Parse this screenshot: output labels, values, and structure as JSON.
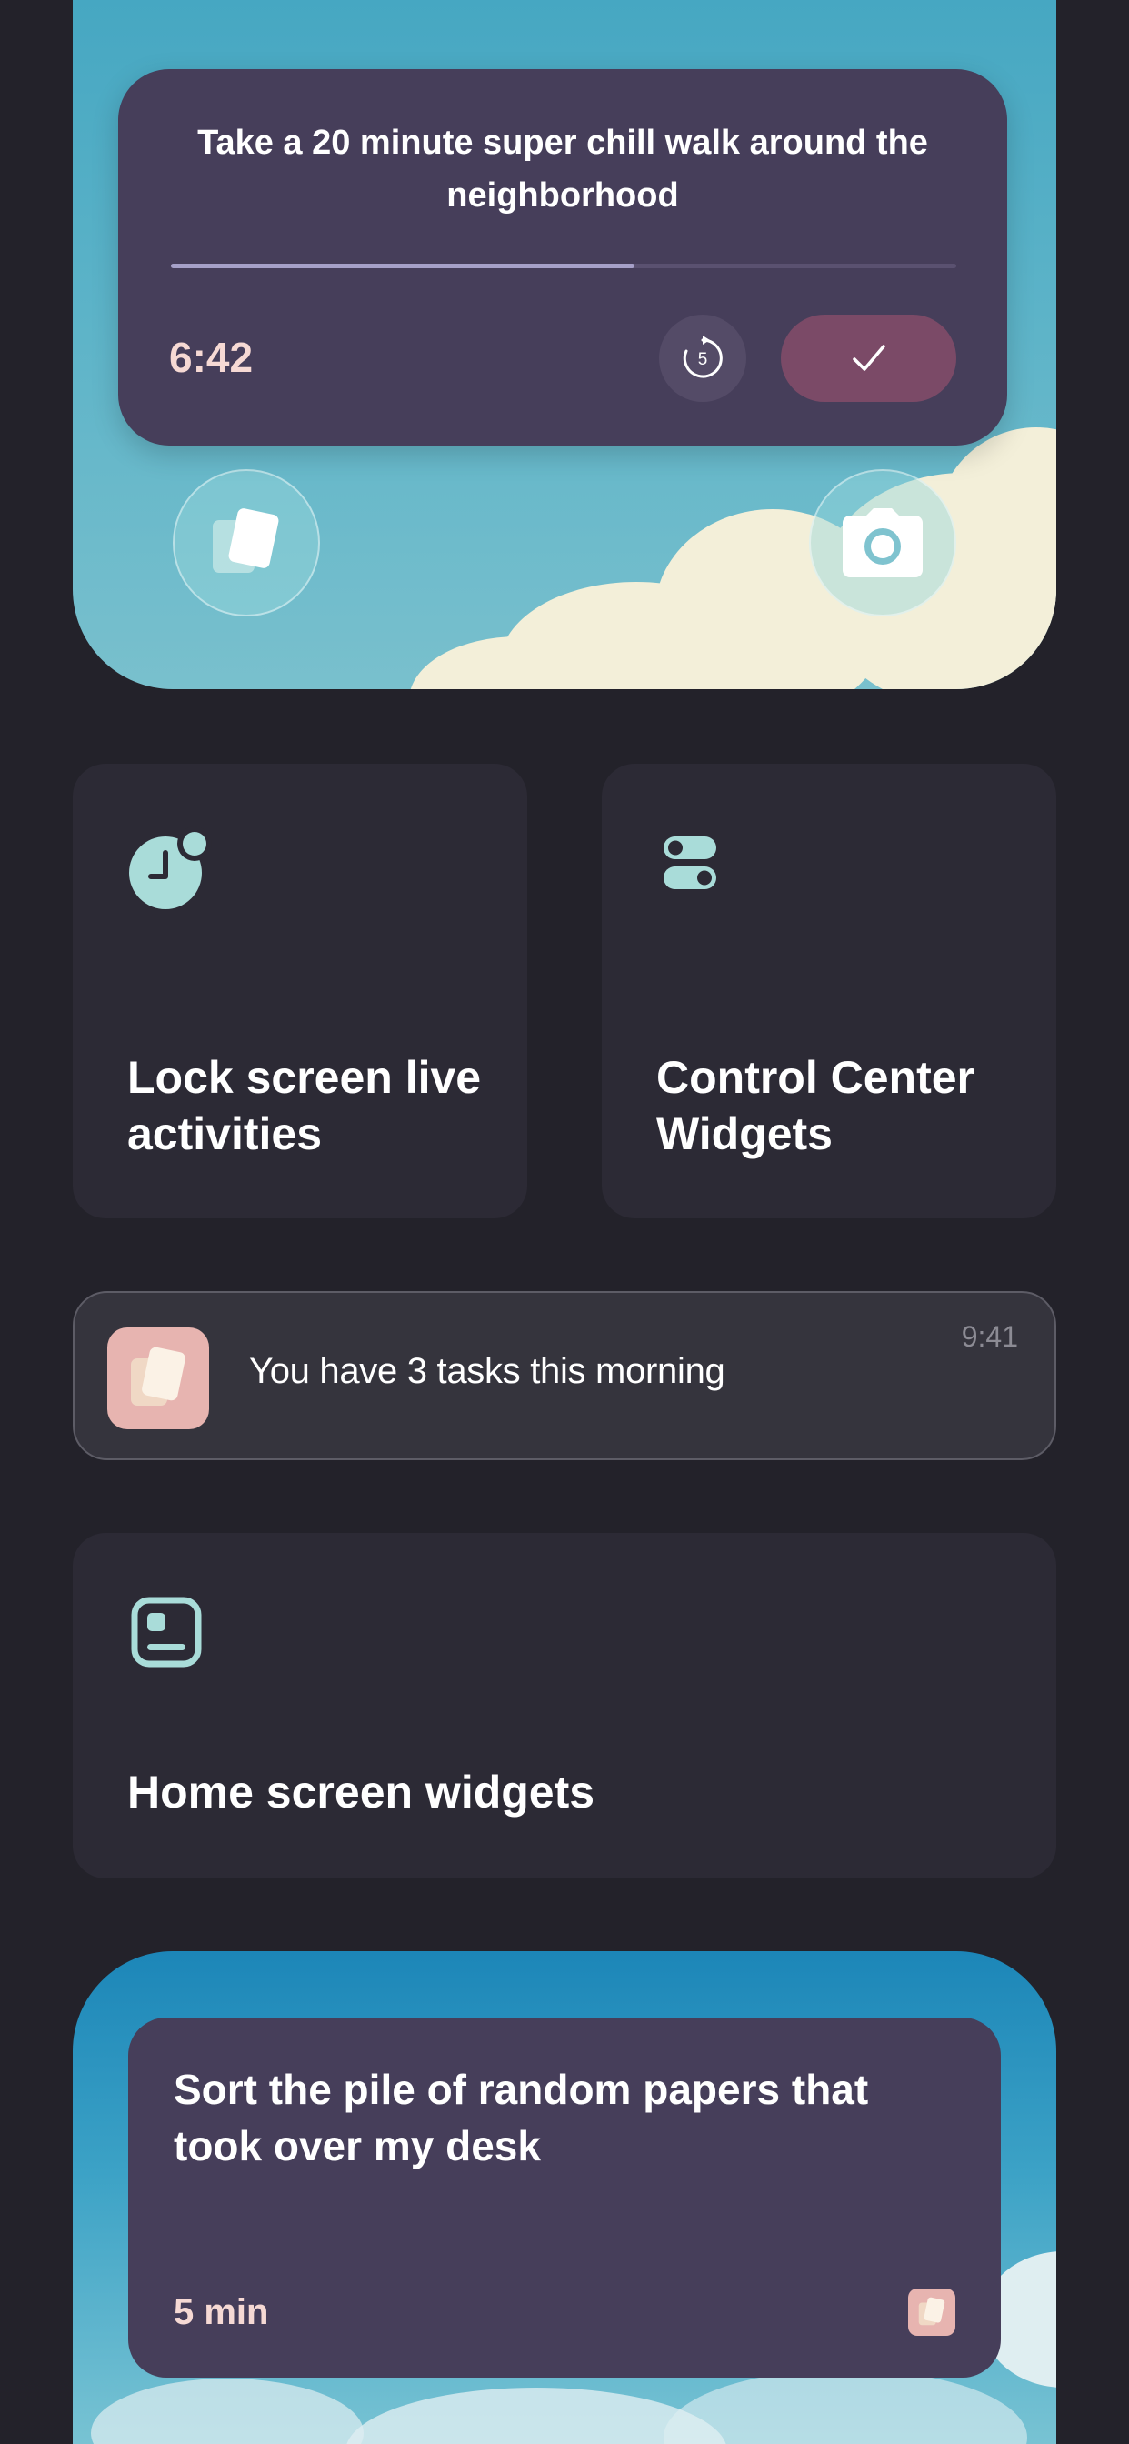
{
  "lock_screen": {
    "live_activity": {
      "task_title": "Take a 20 minute super chill walk around the neighborhood",
      "progress": 0.59,
      "time_remaining": "6:42",
      "timer_icon_number": "5",
      "done_icon": "checkmark-icon",
      "timer_icon": "timer-restart-icon"
    },
    "left_button_icon": "app-cards-icon",
    "right_button_icon": "camera-icon"
  },
  "features": [
    {
      "icon": "clock-badge-icon",
      "label": "Lock screen live activities"
    },
    {
      "icon": "toggles-icon",
      "label": "Control Center Widgets"
    }
  ],
  "notification": {
    "icon": "app-cards-icon",
    "text": "You have 3 tasks this morning",
    "time": "9:41"
  },
  "home_feature": {
    "icon": "widget-frame-icon",
    "label": "Home screen widgets"
  },
  "home_widget": {
    "task_title": "Sort the pile of random papers that took over my desk",
    "duration": "5 min",
    "icon": "app-cards-icon"
  },
  "colors": {
    "background": "#23222a",
    "tile": "#2c2a35",
    "card": "#463e5a",
    "accent_pink": "#f6d9d4",
    "done_button": "#7b4a67",
    "icon_teal": "#a9dcd9"
  }
}
